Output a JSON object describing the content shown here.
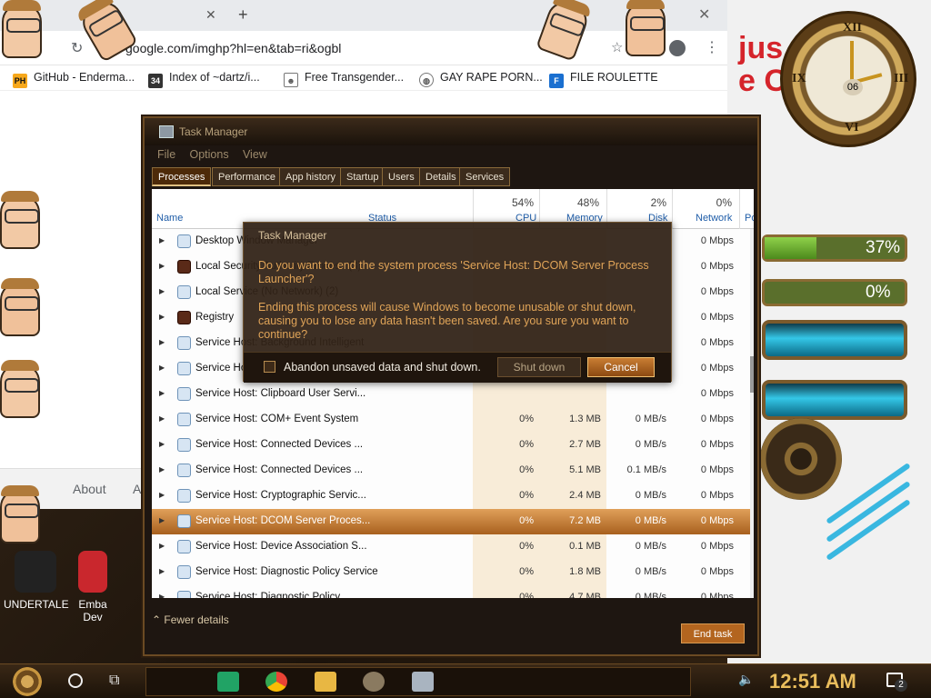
{
  "browser": {
    "url": "google.com/imghp?hl=en&tab=ri&ogbl",
    "bookmarks": [
      {
        "label": "GitHub - Enderma...",
        "fav": "PH",
        "color": "#f7a81b"
      },
      {
        "label": "Index of ~dartz/i...",
        "fav": "34",
        "color": "#333333"
      },
      {
        "label": "Free Transgender...",
        "fav": "",
        "color": "#777777"
      },
      {
        "label": "GAY RAPE PORN...",
        "fav": "",
        "color": "#555555"
      },
      {
        "label": "FILE ROULETTE",
        "fav": "F",
        "color": "#1a6fd0"
      }
    ],
    "footer": {
      "about": "About",
      "a": "A"
    }
  },
  "wallpaper": {
    "brand_line1": "jus",
    "brand_line2": "e O",
    "clock_date": "06",
    "gauge1": {
      "label": "37%",
      "fraction": 0.37
    },
    "gauge2": {
      "label": "0%",
      "fraction": 0.0
    }
  },
  "desktop_icons": [
    {
      "label": "UNDERTALE"
    },
    {
      "label": "Emba"
    },
    {
      "label": "Dev"
    }
  ],
  "taskmgr": {
    "title": "Task Manager",
    "menu": [
      "File",
      "Options",
      "View"
    ],
    "tabs": [
      "Processes",
      "Performance",
      "App history",
      "Startup",
      "Users",
      "Details",
      "Services"
    ],
    "headers": {
      "name": "Name",
      "status": "Status",
      "cpu_pct": "54%",
      "cpu": "CPU",
      "mem_pct": "48%",
      "mem": "Memory",
      "disk_pct": "2%",
      "disk": "Disk",
      "net_pct": "0%",
      "net": "Network",
      "power": "Po"
    },
    "rows": [
      {
        "name": "Desktop Window Manager",
        "cpu": "",
        "mem": "",
        "disk": "",
        "net": "0 Mbps",
        "dark": false
      },
      {
        "name": "Local Security Authority Process (3)",
        "cpu": "",
        "mem": "",
        "disk": "",
        "net": "0 Mbps",
        "dark": true
      },
      {
        "name": "Local Service (No Network) (2)",
        "cpu": "",
        "mem": "",
        "disk": "",
        "net": "0 Mbps",
        "dark": false
      },
      {
        "name": "Registry",
        "cpu": "",
        "mem": "",
        "disk": "",
        "net": "0 Mbps",
        "dark": true
      },
      {
        "name": "Service Host: Background Intelligent",
        "cpu": "",
        "mem": "",
        "disk": "",
        "net": "0 Mbps",
        "dark": false
      },
      {
        "name": "Service Host: Capability Access M...",
        "cpu": "",
        "mem": "",
        "disk": "",
        "net": "0 Mbps",
        "dark": false
      },
      {
        "name": "Service Host: Clipboard User Servi...",
        "cpu": "",
        "mem": "",
        "disk": "",
        "net": "0 Mbps",
        "dark": false
      },
      {
        "name": "Service Host: COM+ Event System",
        "cpu": "0%",
        "mem": "1.3 MB",
        "disk": "0 MB/s",
        "net": "0 Mbps",
        "dark": false
      },
      {
        "name": "Service Host: Connected Devices ...",
        "cpu": "0%",
        "mem": "2.7 MB",
        "disk": "0 MB/s",
        "net": "0 Mbps",
        "dark": false
      },
      {
        "name": "Service Host: Connected Devices ...",
        "cpu": "0%",
        "mem": "5.1 MB",
        "disk": "0.1 MB/s",
        "net": "0 Mbps",
        "dark": false
      },
      {
        "name": "Service Host: Cryptographic Servic...",
        "cpu": "0%",
        "mem": "2.4 MB",
        "disk": "0 MB/s",
        "net": "0 Mbps",
        "dark": false
      },
      {
        "name": "Service Host: DCOM Server Proces...",
        "cpu": "0%",
        "mem": "7.2 MB",
        "disk": "0 MB/s",
        "net": "0 Mbps",
        "dark": false,
        "selected": true
      },
      {
        "name": "Service Host: Device Association S...",
        "cpu": "0%",
        "mem": "0.1 MB",
        "disk": "0 MB/s",
        "net": "0 Mbps",
        "dark": false
      },
      {
        "name": "Service Host: Diagnostic Policy Service",
        "cpu": "0%",
        "mem": "1.8 MB",
        "disk": "0 MB/s",
        "net": "0 Mbps",
        "dark": false
      },
      {
        "name": "Service Host: Diagnostic Policy...",
        "cpu": "0%",
        "mem": "4.7 MB",
        "disk": "0 MB/s",
        "net": "0 Mbps",
        "dark": false
      }
    ],
    "fewer_details": "Fewer details",
    "end_task": "End task"
  },
  "dialog": {
    "title": "Task Manager",
    "message1": "Do you want to end the system process 'Service Host: DCOM Server Process Launcher'?",
    "message2": "Ending this process will cause Windows to become unusable or shut down, causing you to lose any data hasn't been saved. Are you sure you want to continue?",
    "checkbox_label": "Abandon unsaved data and shut down.",
    "shutdown_label": "Shut down",
    "cancel_label": "Cancel"
  },
  "taskbar": {
    "time": "12:51 AM",
    "notifications": "2"
  }
}
